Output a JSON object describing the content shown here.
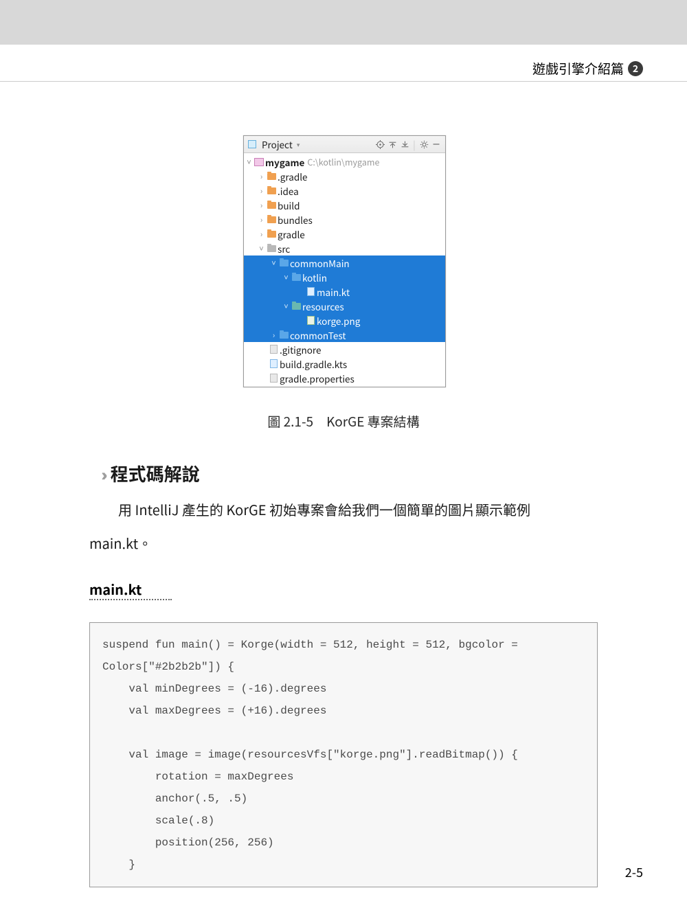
{
  "header": {
    "chapter_label": "遊戲引擎介紹篇",
    "chapter_number": "2"
  },
  "panel": {
    "title": "Project",
    "toolbar_icons": [
      "target",
      "expand-all",
      "collapse-all",
      "gear",
      "minimize"
    ],
    "root_name": "mygame",
    "root_path": "C:\\kotlin\\mygame",
    "folders_top": [
      ".gradle",
      ".idea",
      "build",
      "bundles",
      "gradle"
    ],
    "src_label": "src",
    "selected": {
      "commonMain": "commonMain",
      "kotlin": "kotlin",
      "main_kt": "main.kt",
      "resources": "resources",
      "korge_png": "korge.png",
      "commonTest": "commonTest"
    },
    "files_bottom": [
      ".gitignore",
      "build.gradle.kts",
      "gradle.properties"
    ]
  },
  "caption": "圖 2.1-5　KorGE 專案結構",
  "section_heading": "程式碼解說",
  "paragraph_line1": "用 IntelliJ 產生的 KorGE 初始專案會給我們一個簡單的圖片顯示範例",
  "paragraph_line2": "main.kt。",
  "file_heading": "main.kt",
  "code": "suspend fun main() = Korge(width = 512, height = 512, bgcolor = \nColors[\"#2b2b2b\"]) {\n    val minDegrees = (-16).degrees\n    val maxDegrees = (+16).degrees\n\n    val image = image(resourcesVfs[\"korge.png\"].readBitmap()) {\n        rotation = maxDegrees\n        anchor(.5, .5)\n        scale(.8)\n        position(256, 256)\n    }",
  "page_number": "2-5"
}
